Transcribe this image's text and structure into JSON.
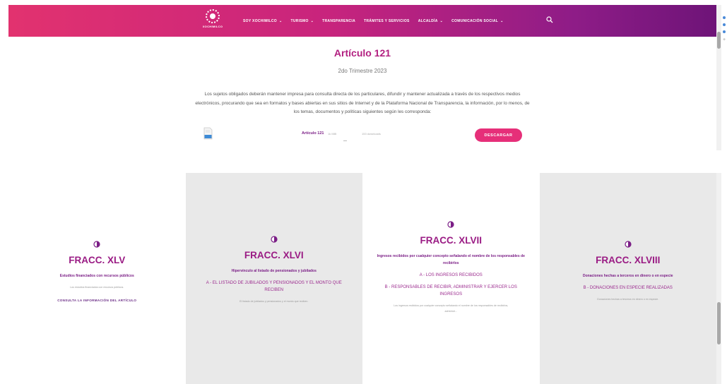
{
  "header": {
    "logo_text": "XOCHIMILCO",
    "nav": [
      {
        "label": "SOY XOCHIMILCO",
        "caret": "⌄"
      },
      {
        "label": "TURISMO",
        "caret": "⌄"
      },
      {
        "label": "TRANSPARENCIA",
        "caret": ""
      },
      {
        "label": "TRÁMITES Y SERVICIOS",
        "caret": ""
      },
      {
        "label": "ALCALDÍA",
        "caret": "⌄"
      },
      {
        "label": "COMUNICACIÓN SOCIAL",
        "caret": "⌄"
      }
    ],
    "search_icon": "search-icon",
    "gradient": [
      "#e2326f",
      "#c8247d",
      "#8e1c87",
      "#6e1478"
    ]
  },
  "article": {
    "title": "Artículo 121",
    "subtitle": "2do Trimestre 2023",
    "body": "Los sujetos obligados deberán mantener impresa para consulta directa de los particulares, difundir y mantener actualizada a través de los respectivos medios electrónicos, procurando que sea en formatos y bases abiertas en sus sitios de Internet y de la Plataforma Nacional de Transparencia, la información, por lo menos, de los temas, documentos y políticas siguientes según les corresponda:",
    "file": {
      "label": "Artículo 121",
      "meta_size": "1k MiB",
      "meta_downloads": "153 downloads",
      "icon": "document-icon"
    },
    "download_label": "DESCARGAR",
    "accent": "#e62f79",
    "title_color": "#b21f80"
  },
  "cards": [
    {
      "title": "FRACC. XLV",
      "description": "Estudios financiados con recursos públicos",
      "items": [],
      "note": "Los estudios financiados con recursos públicos.",
      "link": "CONSULTA LA INFORMACIÓN DEL ARTÍCULO",
      "icon": "half-circle-icon"
    },
    {
      "title": "FRACC. XLVI",
      "description": "Hipervínculo al listado de pensionados y jubilados",
      "items": [
        "A - EL LISTADO DE JUBILADOS Y PENSIONADOS Y EL MONTO QUE RECIBEN"
      ],
      "note": "El listado de jubilados y pensionados y el monto que reciben.",
      "link": "",
      "icon": "half-circle-icon"
    },
    {
      "title": "FRACC. XLVII",
      "description": "Ingresos recibidos por cualquier concepto señalando el nombre de los responsables de recibirlos",
      "items": [
        "A - LOS INGRESOS RECIBIDOS",
        "B - RESPONSABLES DE RECIBIR, ADMINISTRAR Y EJERCER LOS INGRESOS"
      ],
      "note": "Los ingresos recibidos por cualquier concepto señalando el nombre de los responsables de recibirlos, administr...",
      "link": "",
      "icon": "half-circle-icon"
    },
    {
      "title": "FRACC. XLVIII",
      "description": "Donaciones hechas a terceros en dinero o en especie",
      "items": [
        "B - DONACIONES EN ESPECIE REALIZADAS"
      ],
      "note": "Donaciones hechas a terceros en dinero o en especie.",
      "link": "",
      "icon": "half-circle-icon"
    }
  ]
}
